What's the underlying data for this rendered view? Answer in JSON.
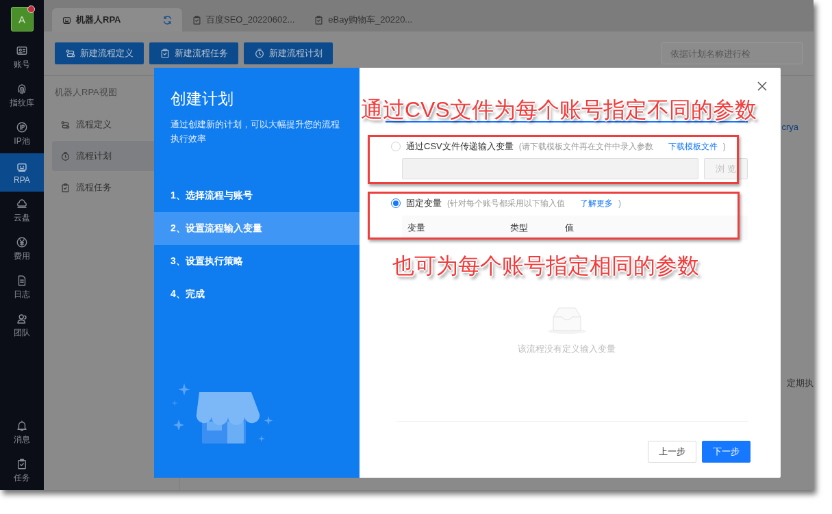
{
  "app": {
    "avatar": "A",
    "notification": true
  },
  "nav": [
    {
      "label": "账号",
      "selected": false
    },
    {
      "label": "指纹库",
      "selected": false
    },
    {
      "label": "IP池",
      "selected": false
    },
    {
      "label": "RPA",
      "selected": true
    },
    {
      "label": "云盘",
      "selected": false
    },
    {
      "label": "费用",
      "selected": false
    },
    {
      "label": "日志",
      "selected": false
    },
    {
      "label": "团队",
      "selected": false
    }
  ],
  "nav_bottom": [
    {
      "label": "消息",
      "selected": false
    },
    {
      "label": "任务",
      "selected": false
    }
  ],
  "tabs": [
    {
      "label": "机器人RPA",
      "selected": true,
      "refresh": true
    },
    {
      "label": "百度SEO_20220602...",
      "selected": false,
      "refresh": false
    },
    {
      "label": "eBay购物车_20220...",
      "selected": false,
      "refresh": false
    }
  ],
  "toolbar": [
    {
      "label": "新建流程定义"
    },
    {
      "label": "新建流程任务"
    },
    {
      "label": "新建流程计划"
    }
  ],
  "search": {
    "placeholder": "依据计划名称进行检"
  },
  "side_panel": {
    "title": "机器人RPA视图",
    "items": [
      {
        "label": "流程定义",
        "selected": false
      },
      {
        "label": "流程计划",
        "selected": true
      },
      {
        "label": "流程任务",
        "selected": false
      }
    ]
  },
  "background_texts": [
    "crya",
    "定期执"
  ],
  "dialog": {
    "title": "创建计划",
    "description": "通过创建新的计划，可以大幅提升您的流程执行效率",
    "steps": [
      {
        "label": "1、选择流程与账号",
        "selected": false
      },
      {
        "label": "2、设置流程输入变量",
        "selected": true
      },
      {
        "label": "3、设置执行策略",
        "selected": false
      },
      {
        "label": "4、完成",
        "selected": false
      }
    ],
    "options": [
      {
        "kind": "file",
        "label": "通过CSV文件传递输入变量",
        "hint": "(请下载模板文件再在文件中录入参数",
        "link": "下载模板文件",
        "hint_end": ")",
        "selected": false,
        "button": "浏 览",
        "disabled": true
      },
      {
        "kind": "table",
        "label": "固定变量",
        "hint": "(针对每个账号都采用以下输入值",
        "link": "了解更多",
        "hint_end": ")",
        "selected": true,
        "columns": [
          "变量",
          "类型",
          "值"
        ]
      }
    ],
    "empty_text": "该流程没有定义输入变量",
    "buttons": [
      {
        "label": "上一步",
        "kind": "default"
      },
      {
        "label": "下一步",
        "kind": "primary"
      }
    ]
  },
  "annotations": [
    {
      "text": "通过CVS文件为每个账号指定不同的参数"
    },
    {
      "text": "也可为每个账号指定相同的参数"
    }
  ]
}
